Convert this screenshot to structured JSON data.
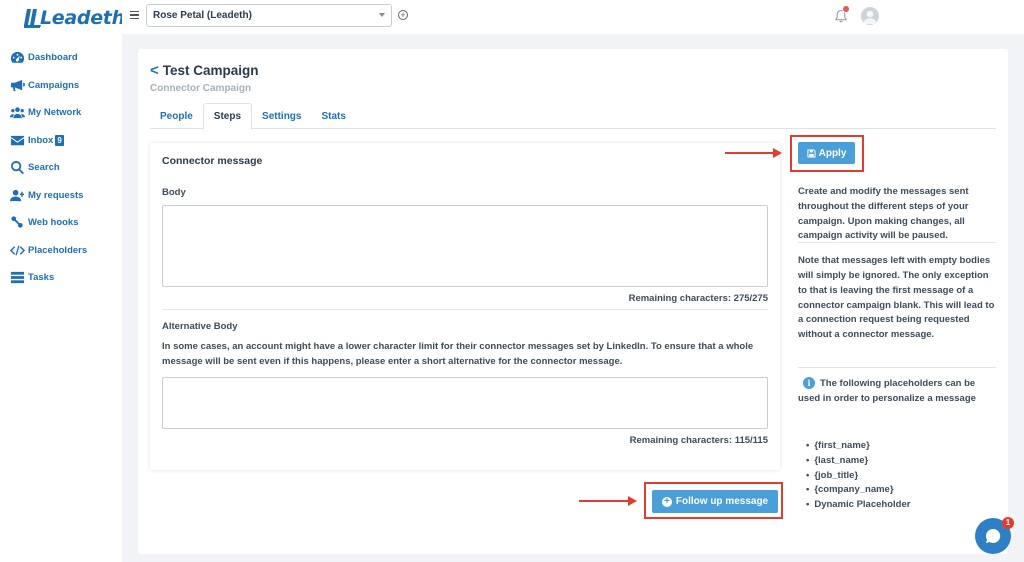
{
  "app": {
    "brand": "Leadeth"
  },
  "sidebar": {
    "items": [
      {
        "label": "Dashboard",
        "icon": "dashboard-icon"
      },
      {
        "label": "Campaigns",
        "icon": "megaphone-icon"
      },
      {
        "label": "My Network",
        "icon": "users-icon"
      },
      {
        "label": "Inbox",
        "icon": "envelope-icon",
        "badge": "9"
      },
      {
        "label": "Search",
        "icon": "search-icon"
      },
      {
        "label": "My requests",
        "icon": "user-plus-icon"
      },
      {
        "label": "Web hooks",
        "icon": "webhook-icon"
      },
      {
        "label": "Placeholders",
        "icon": "code-icon"
      },
      {
        "label": "Tasks",
        "icon": "tasks-icon"
      }
    ]
  },
  "topbar": {
    "account": "Rose Petal (Leadeth)",
    "add_symbol": "+"
  },
  "campaign": {
    "title": "Test Campaign",
    "subtitle": "Connector Campaign",
    "back_symbol": "<"
  },
  "tabs": [
    {
      "label": "People",
      "active": false
    },
    {
      "label": "Steps",
      "active": true
    },
    {
      "label": "Settings",
      "active": false
    },
    {
      "label": "Stats",
      "active": false
    }
  ],
  "message": {
    "title": "Connector message",
    "body_label": "Body",
    "body_value": "",
    "body_remaining": "Remaining characters: 275/275",
    "alt_label": "Alternative Body",
    "alt_description": "In some cases, an account might have a lower character limit for their connector messages set by LinkedIn. To ensure that a whole message will be sent even if this happens, please enter a short alternative for the connector message.",
    "alt_value": "",
    "alt_remaining": "Remaining characters: 115/115"
  },
  "actions": {
    "apply_label": "Apply",
    "follow_up_label": "Follow up message",
    "follow_up_symbol": "+"
  },
  "info": {
    "para1": "Create and modify the messages sent throughout the different steps of your campaign. Upon making changes, all campaign activity will be paused.",
    "para2": "Note that messages left with empty bodies will simply be ignored. The only exception to that is leaving the first message of a connector campaign blank. This will lead to a connection request being requested without a connector message.",
    "info_symbol": "i",
    "placeholders_intro": "The following placeholders can be used in order to personalize a message",
    "placeholders": [
      "{first_name}",
      "{last_name}",
      "{job_title}",
      "{company_name}",
      "Dynamic Placeholder"
    ]
  },
  "chat": {
    "badge": "1"
  },
  "colors": {
    "brand": "#1f6fb5",
    "button": "#4a9fd8",
    "highlight": "#e03d2e",
    "notification": "#e8584f"
  }
}
